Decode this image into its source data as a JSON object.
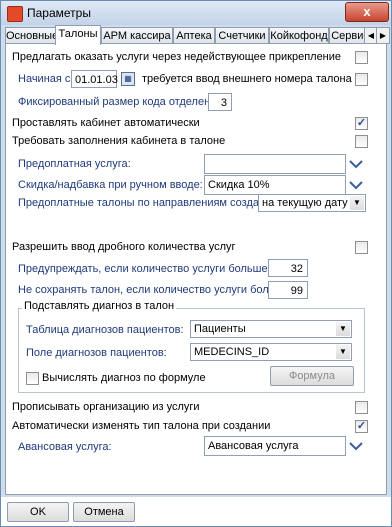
{
  "window": {
    "title": "Параметры",
    "close_label": "x"
  },
  "tabs": [
    "Основные",
    "Талоны",
    "АРМ кассира",
    "Аптека",
    "Счетчики",
    "Койкофонд",
    "Сервисы"
  ],
  "tabs_active_index": 1,
  "settings": {
    "offer_services": {
      "label": "Предлагать оказать услуги через недействующее прикрепление",
      "checked": false
    },
    "starting_from": {
      "label": "Начиная с",
      "date": "01.01.03",
      "suffix": "требуется ввод внешнего номера талона",
      "checked": false
    },
    "fixed_code": {
      "label": "Фиксированный размер кода отделения:",
      "value": "3"
    },
    "auto_cabinet": {
      "label": "Проставлять кабинет автоматически",
      "checked": true
    },
    "require_cabinet": {
      "label": "Требовать заполнения кабинета в талоне",
      "checked": false
    },
    "prepaid_service": {
      "label": "Предоплатная услуга:",
      "value": ""
    },
    "discount": {
      "label": "Скидка/надбавка при ручном вводе:",
      "value": "Скидка 10%"
    },
    "prepaid_talons": {
      "label": "Предоплатные талоны по направлениям создавать:",
      "value": "на текущую дату"
    },
    "fractional": {
      "label": "Разрешить ввод дробного количества услуг",
      "checked": false
    },
    "warn_count": {
      "label": "Предупреждать, если количество услуги больше:",
      "value": "32"
    },
    "no_save_count": {
      "label": "Не сохранять талон, если количество услуги больше:",
      "value": "99"
    },
    "diagnosis_group": {
      "title": "Подставлять диагноз в талон",
      "table_label": "Таблица диагнозов пациентов:",
      "table_value": "Пациенты",
      "field_label": "Поле диагнозов пациентов:",
      "field_value": "MEDECINS_ID",
      "formula_label": "Вычислять диагноз по формуле",
      "formula_checked": false,
      "formula_button": "Формула"
    },
    "write_org": {
      "label": "Прописывать организацию из услуги",
      "checked": false
    },
    "auto_change_type": {
      "label": "Автоматически изменять тип талона при создании",
      "checked": true
    },
    "advance_service": {
      "label": "Авансовая услуга:",
      "value": "Авансовая услуга"
    }
  },
  "footer": {
    "ok_label": "OK",
    "cancel_label": "Отмена"
  },
  "icons": {
    "chevron": "chevron-down-icon",
    "calendar": "calendar-icon",
    "close": "close-icon",
    "app": "app-icon"
  }
}
